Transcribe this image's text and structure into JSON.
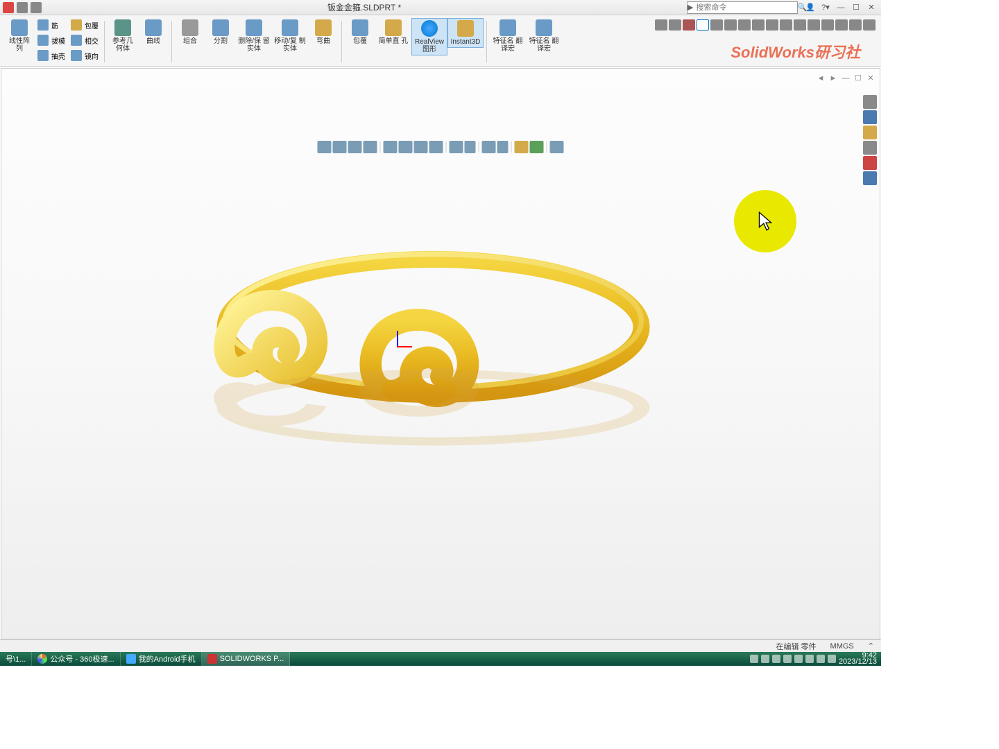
{
  "titlebar": {
    "filename": "钣金金箍.SLDPRT *"
  },
  "search": {
    "placeholder": "搜索命令"
  },
  "watermark": "SolidWorks研习社",
  "ribbon": {
    "linpat": "线性阵\n列",
    "rib": "筋",
    "baofu": "包覆",
    "bamo": "拔模",
    "xiangjiao": "相交",
    "chouke": "抽壳",
    "jingxiang": "镜向",
    "cankao": "参考几\n何体",
    "quxian": "曲线",
    "zuhe": "组合",
    "fenge": "分割",
    "shanchu": "删除/保\n留实体",
    "yidong": "移动/复\n制实体",
    "wanqu": "弯曲",
    "baofu2": "包覆",
    "jiandan": "简单直\n孔",
    "realview": "RealView\n图形",
    "instant3d": "Instant3D",
    "tezhengming": "特征名\n翻译宏",
    "tezhengming2": "特征名\n翻译宏"
  },
  "statusbar": {
    "edit": "在编辑 零件",
    "units": "MMGS"
  },
  "taskbar": {
    "item1": "号\\1...",
    "item2": "公众号 - 360极速...",
    "item3": "我的Android手机",
    "item4": "SOLIDWORKS P...",
    "time": "9:42",
    "date": "2023/12/13"
  }
}
